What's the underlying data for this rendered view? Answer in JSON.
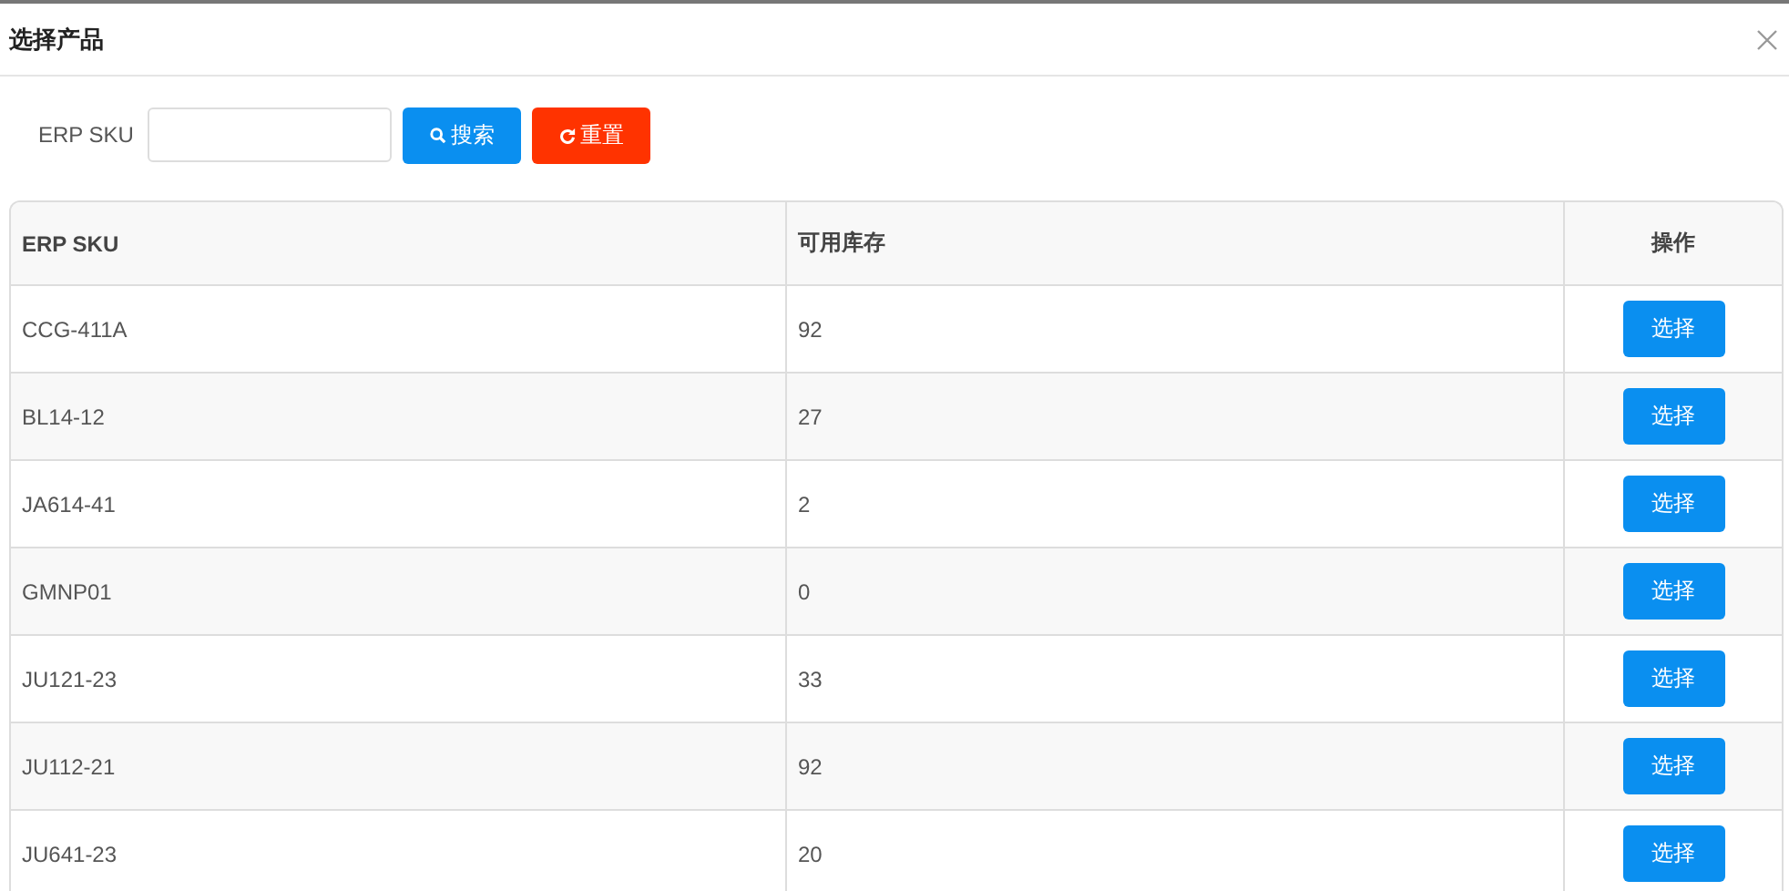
{
  "dialog": {
    "title": "选择产品"
  },
  "search": {
    "label": "ERP SKU",
    "buttons": [
      {
        "kind": "search",
        "label": "搜索"
      },
      {
        "kind": "reset",
        "label": "重置"
      }
    ]
  },
  "table": {
    "columns": [
      "ERP SKU",
      "可用库存",
      "操作"
    ],
    "rows": [
      {
        "sku": "CCG-411A",
        "stock": "92",
        "action": "选择"
      },
      {
        "sku": "BL14-12",
        "stock": "27",
        "action": "选择"
      },
      {
        "sku": "JA614-41",
        "stock": "2",
        "action": "选择"
      },
      {
        "sku": "GMNP01",
        "stock": "0",
        "action": "选择"
      },
      {
        "sku": "JU121-23",
        "stock": "33",
        "action": "选择"
      },
      {
        "sku": "JU112-21",
        "stock": "92",
        "action": "选择"
      },
      {
        "sku": "JU641-23",
        "stock": "20",
        "action": "选择"
      }
    ]
  }
}
